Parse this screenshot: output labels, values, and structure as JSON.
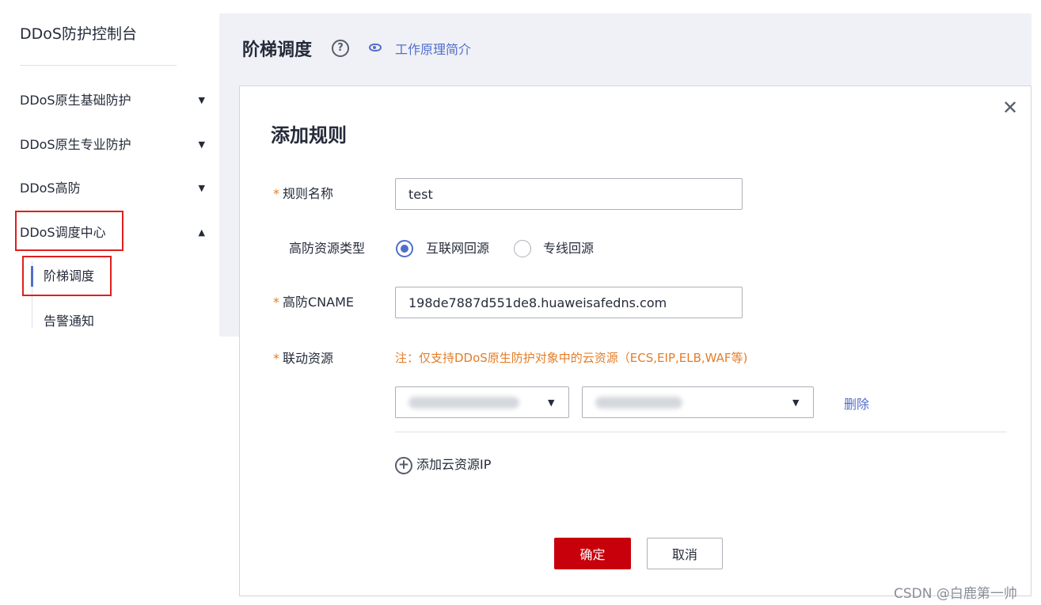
{
  "sidebar": {
    "title": "DDoS防护控制台",
    "items": [
      {
        "label": "DDoS原生基础防护",
        "caret": "▼"
      },
      {
        "label": "DDoS原生专业防护",
        "caret": "▼"
      },
      {
        "label": "DDoS高防",
        "caret": "▼"
      },
      {
        "label": "DDoS调度中心",
        "caret": "▲"
      }
    ],
    "sub_items": [
      {
        "label": "阶梯调度",
        "active": true
      },
      {
        "label": "告警通知",
        "active": false
      }
    ]
  },
  "header": {
    "title": "阶梯调度",
    "help_glyph": "?",
    "intro_link": "工作原理简介"
  },
  "dialog": {
    "title": "添加规则",
    "close_glyph": "✕",
    "fields": {
      "rule_name": {
        "label": "规则名称",
        "required_mark": "*",
        "value": "test"
      },
      "resource_type": {
        "label": "高防资源类型",
        "options": [
          "互联网回源",
          "专线回源"
        ],
        "selected": "互联网回源"
      },
      "cname": {
        "label": "高防CNAME",
        "required_mark": "*",
        "value": "198de7887d551de8.huaweisafedns.com"
      },
      "linked_resource": {
        "label": "联动资源",
        "required_mark": "*",
        "note": "注：仅支持DDoS原生防护对象中的云资源（ECS,EIP,ELB,WAF等)",
        "delete_label": "删除",
        "add_label": "添加云资源IP"
      }
    },
    "buttons": {
      "confirm": "确定",
      "cancel": "取消"
    }
  },
  "watermark": "CSDN @白鹿第一帅",
  "colors": {
    "accent": "#526ecc",
    "primary_button": "#c7000b",
    "required_mark": "#e37d29",
    "highlight_box": "#e01e1e",
    "header_bg": "#eff1f6"
  },
  "icons": [
    "question-circle-icon",
    "eye-icon",
    "close-icon",
    "chevron-down-icon",
    "chevron-up-icon",
    "plus-circle-icon"
  ]
}
